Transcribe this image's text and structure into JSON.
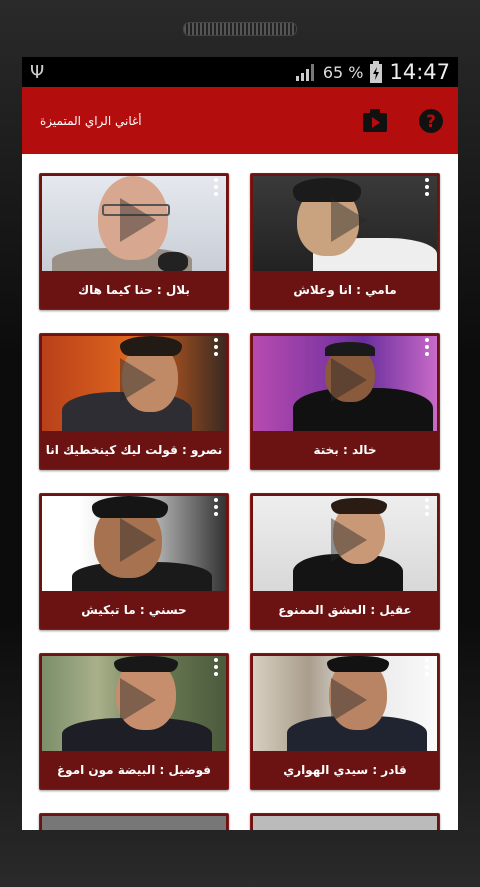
{
  "status": {
    "battery": "65 %",
    "time": "14:47"
  },
  "header": {
    "title": "أغاني الراي المتميزة"
  },
  "icons": {
    "usb": "usb-icon",
    "signal": "signal-icon",
    "battery": "battery-charging-icon",
    "video": "video-play-icon",
    "help": "help-icon",
    "more": "more-vert-icon"
  },
  "videos": [
    {
      "title": "مامي : انا وعلاش"
    },
    {
      "title": "بلال : حنا كيما هاك"
    },
    {
      "title": "خالد : بختة"
    },
    {
      "title": "نصرو : قولت ليك كينخطيك انا"
    },
    {
      "title": "عقيل : العشق الممنوع"
    },
    {
      "title": "حسني : ما تبكيش"
    },
    {
      "title": "قادر : سيدي الهواري"
    },
    {
      "title": "فوضيل : البيضة مون اموغ"
    }
  ],
  "colors": {
    "accent": "#b40d0d",
    "card": "#6b1212"
  }
}
